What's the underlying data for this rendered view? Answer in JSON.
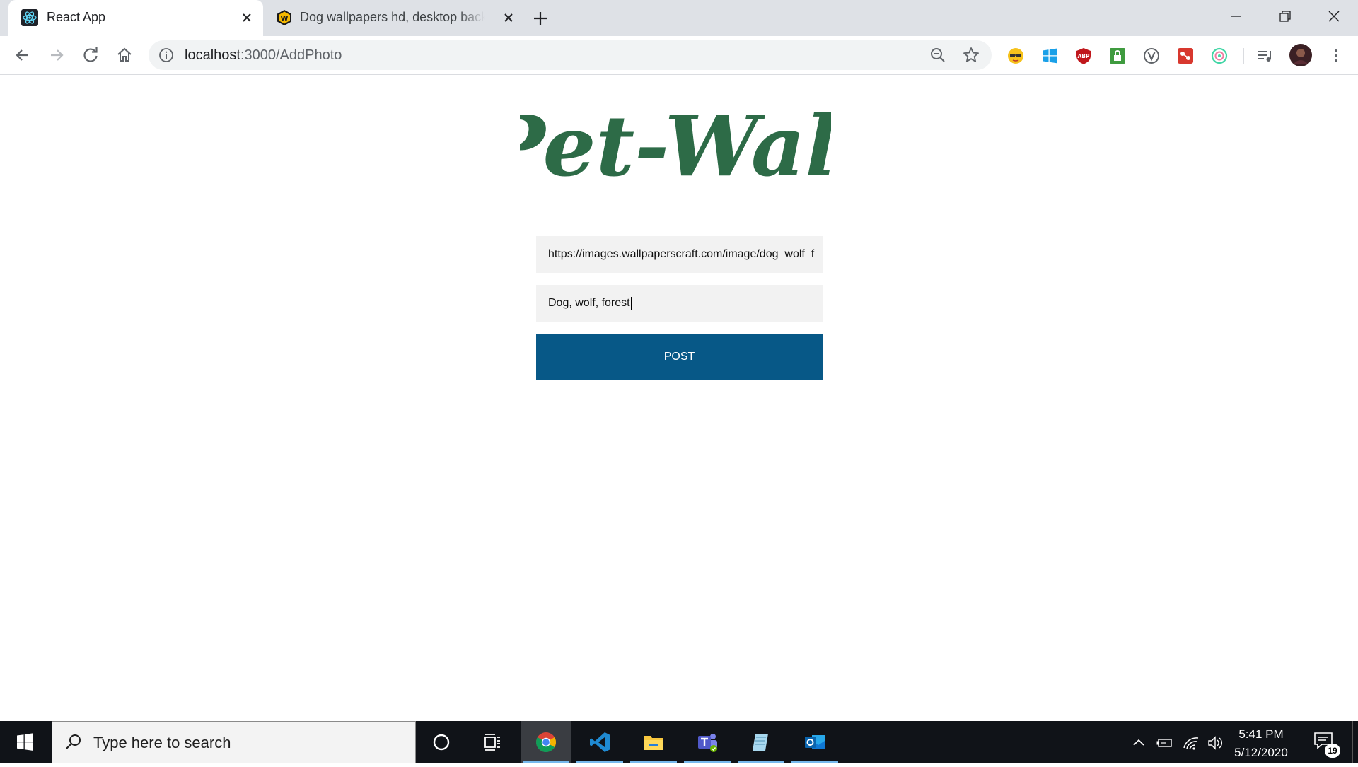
{
  "browser": {
    "tabs": [
      {
        "title": "React App",
        "favicon": "react-icon",
        "active": true
      },
      {
        "title": "Dog wallpapers hd, desktop backgrounds",
        "favicon": "wallpaperscraft-icon",
        "active": false
      }
    ],
    "address": {
      "host": "localhost",
      "path": ":3000/AddPhoto"
    },
    "extensions": [
      "glasses-extension-icon",
      "windows-extension-icon",
      "adblock-extension-icon",
      "lock-extension-icon",
      "v-extension-icon",
      "red-extension-icon",
      "circle-extension-icon"
    ]
  },
  "page": {
    "logo_text": "Pet-Wall",
    "logo_color": "#2d6b47",
    "url_field_value": "https://images.wallpaperscraft.com/image/dog_wolf_f",
    "tags_field_value": "Dog, wolf, forest",
    "post_label": "POST",
    "accent": "#075887"
  },
  "taskbar": {
    "search_placeholder": "Type here to search",
    "time": "5:41 PM",
    "date": "5/12/2020",
    "notification_count": "19",
    "apps": [
      "cortana-icon",
      "task-view-icon",
      "chrome-icon",
      "vscode-icon",
      "file-explorer-icon",
      "teams-icon",
      "notepad-icon",
      "outlook-icon"
    ]
  }
}
